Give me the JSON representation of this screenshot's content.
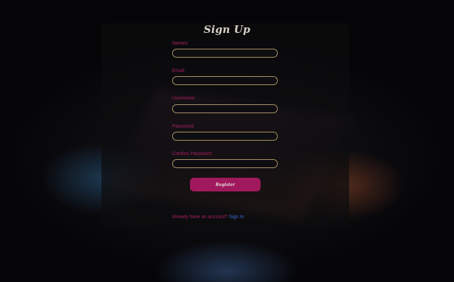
{
  "form": {
    "title": "Sign Up",
    "fields": [
      {
        "label": "Names:",
        "value": ""
      },
      {
        "label": "Email:",
        "value": ""
      },
      {
        "label": "Username:",
        "value": ""
      },
      {
        "label": "Password:",
        "value": ""
      },
      {
        "label": "Confirm Password:",
        "value": ""
      }
    ],
    "register_label": "Register",
    "signin_prompt": "Already have an account?",
    "signin_link": "Sign In"
  },
  "colors": {
    "label": "#a91f61",
    "button": "#a0195c",
    "input_border": "#b0986a",
    "link": "#3a6fd4",
    "title": "#d6d0c6"
  }
}
